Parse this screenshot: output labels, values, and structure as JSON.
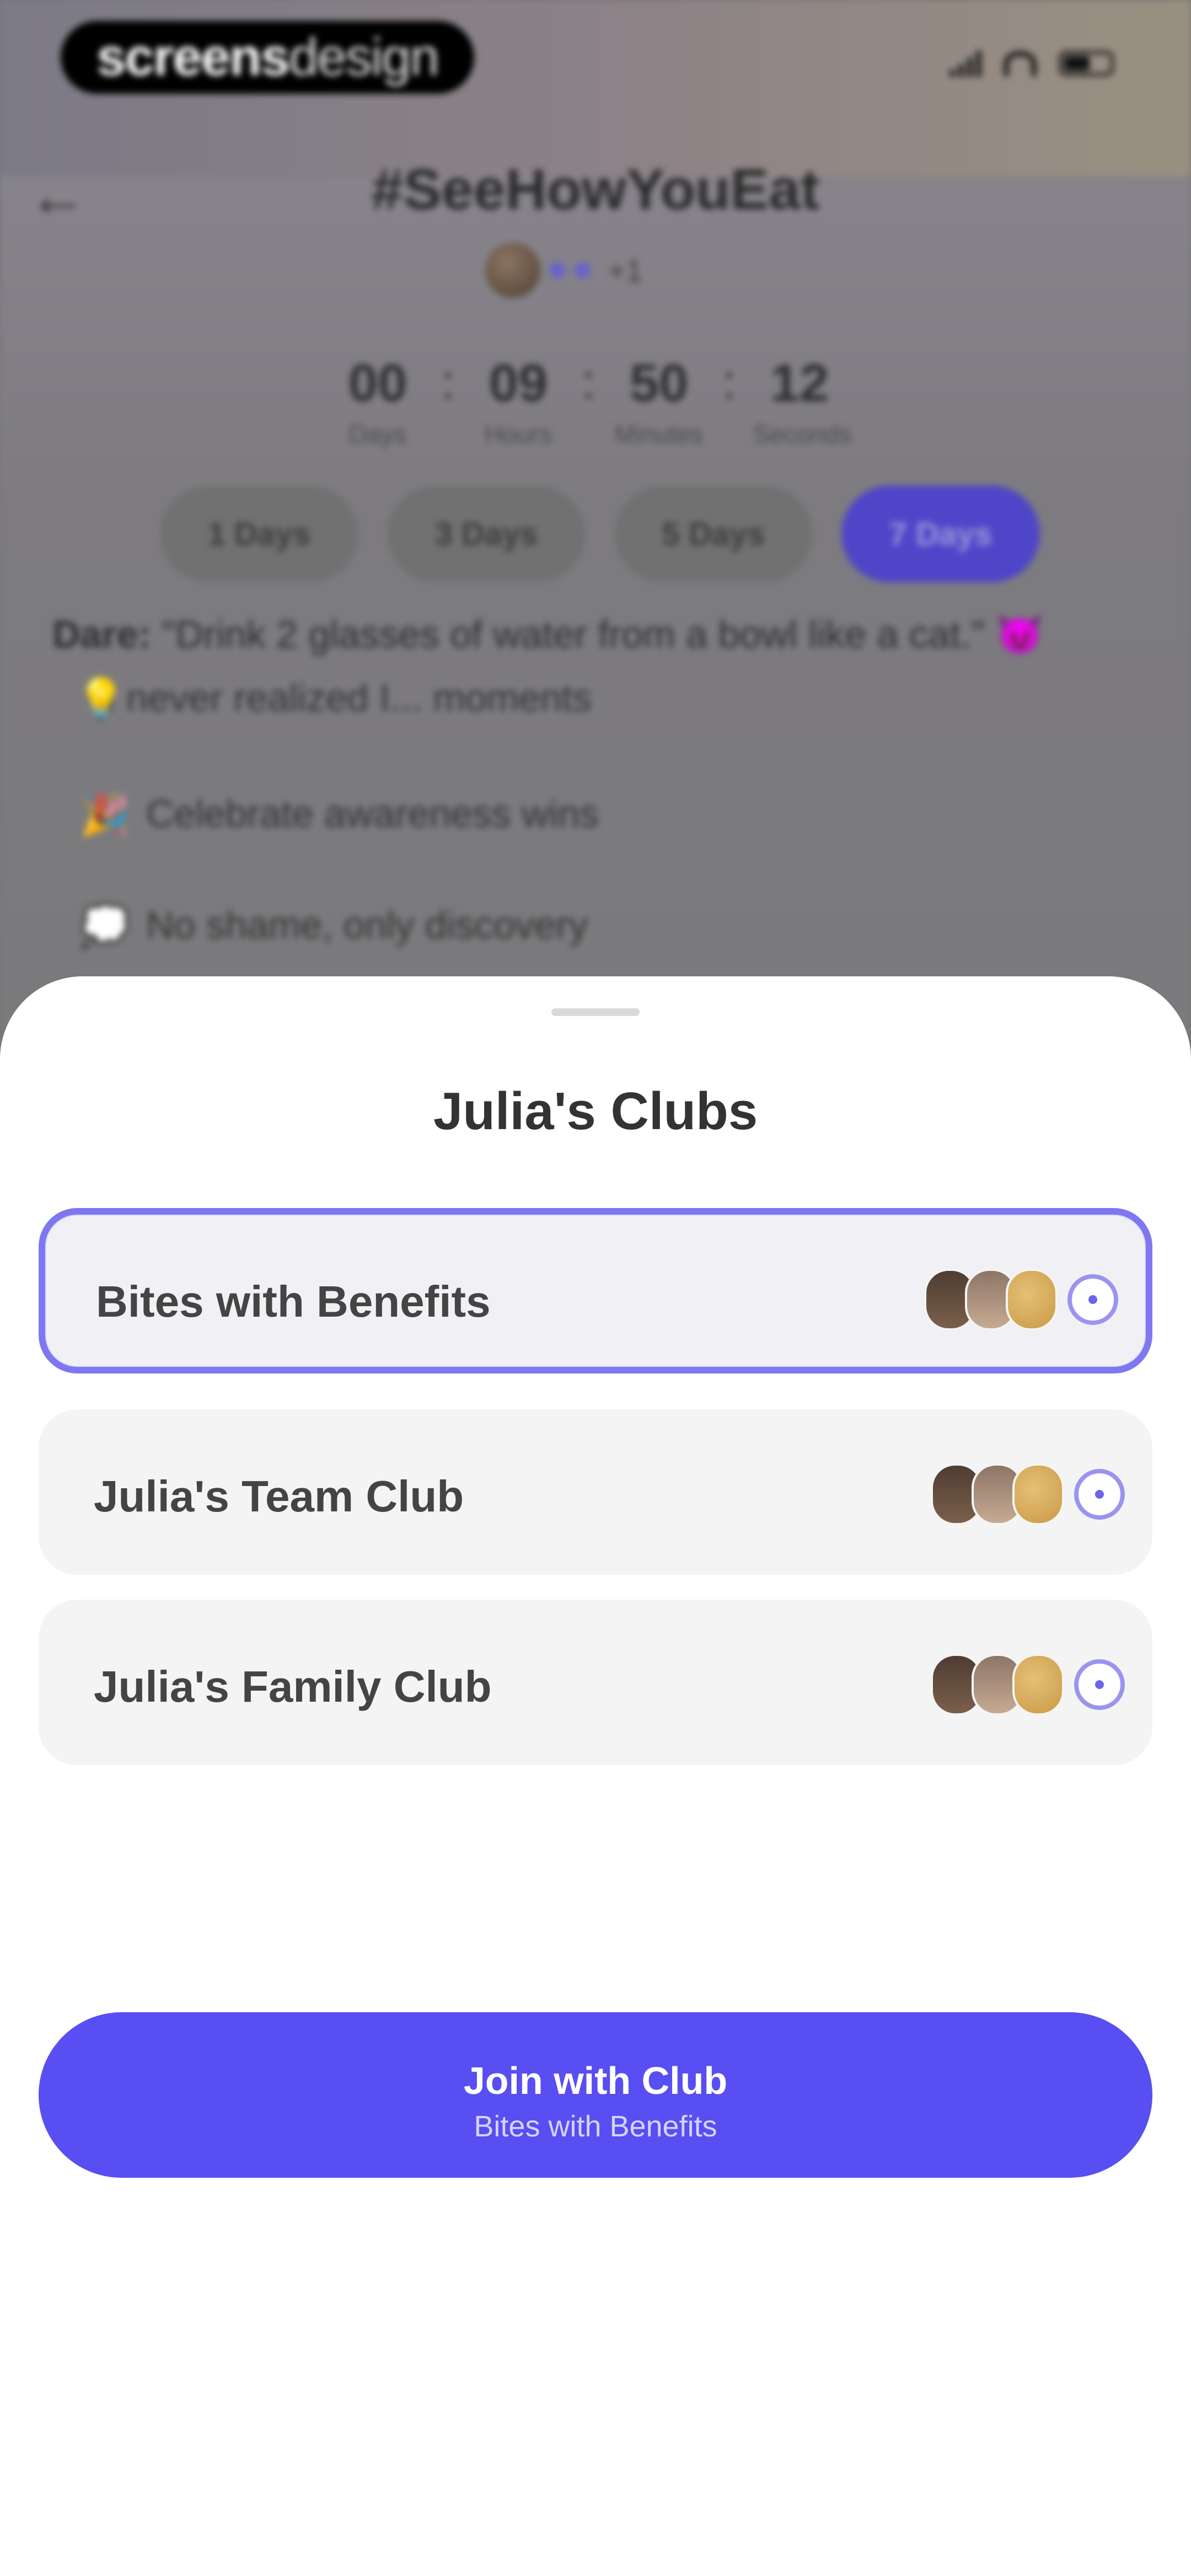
{
  "status_bar": {
    "logo_bold": "screens",
    "logo_light": "design"
  },
  "header": {
    "title": "#SeeHowYouEat",
    "participants_more": "+1"
  },
  "countdown": [
    {
      "value": "00",
      "label": "Days"
    },
    {
      "value": "09",
      "label": "Hours"
    },
    {
      "value": "50",
      "label": "Minutes"
    },
    {
      "value": "12",
      "label": "Seconds"
    }
  ],
  "day_tabs": [
    "1 Days",
    "3 Days",
    "5 Days",
    "7 Days"
  ],
  "dare": {
    "label": "Dare:",
    "text": "\"Drink 2 glasses of water from a bowl like a cat.\" 😈"
  },
  "notes": [
    {
      "emoji": "💡",
      "text": "I never realized I... moments"
    },
    {
      "emoji": "🎉",
      "text": "Celebrate awareness wins"
    },
    {
      "emoji": "💭",
      "text": "No shame, only discovery"
    }
  ],
  "sheet": {
    "title": "Julia's Clubs",
    "clubs": [
      {
        "name": "Bites with Benefits",
        "selected": true
      },
      {
        "name": "Julia's Team Club",
        "selected": false
      },
      {
        "name": "Julia's Family Club",
        "selected": false
      }
    ],
    "join_button": {
      "label": "Join with Club",
      "sublabel": "Bites with Benefits"
    }
  },
  "colors": {
    "accent": "#584ef1",
    "selected_border": "#7f77f0"
  }
}
